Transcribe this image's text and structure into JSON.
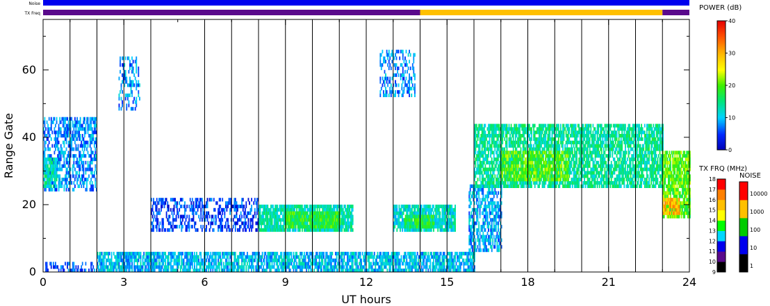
{
  "chart_data": {
    "type": "heatmap",
    "title": "",
    "xlabel": "UT hours",
    "ylabel": "Range Gate",
    "xlim": [
      0,
      24
    ],
    "ylim": [
      0,
      75
    ],
    "x_ticks": [
      0,
      3,
      6,
      9,
      12,
      15,
      18,
      21,
      24
    ],
    "y_ticks": [
      0,
      20,
      40,
      60
    ],
    "grid": false,
    "scan_boundaries_ut": [
      1.0,
      2.0,
      3.0,
      4.0,
      6.0,
      7.0,
      8.0,
      9.0,
      10.0,
      11.0,
      12.0,
      13.0,
      14.0,
      15.0,
      16.0,
      17.0,
      18.0,
      19.0,
      20.0,
      21.0,
      22.0,
      23.0
    ],
    "top_strips": {
      "noise_label": "Noise",
      "txfreq_label": "TX Freq",
      "noise_color": "#0000ee",
      "txfreq_segments": [
        {
          "start": 0,
          "end": 14.0,
          "color": "#5a0a8c"
        },
        {
          "start": 14.0,
          "end": 23.0,
          "color": "#ffc000"
        },
        {
          "start": 23.0,
          "end": 24.0,
          "color": "#5a0a8c"
        }
      ]
    },
    "power_colorbar": {
      "title": "POWER (dB)",
      "ticks": [
        0,
        10,
        20,
        30,
        40
      ],
      "range": [
        0,
        40
      ]
    },
    "txfreq_colorbar": {
      "title": "TX FRQ (MHz)",
      "ticks": [
        9,
        10,
        11,
        12,
        13,
        14,
        15,
        16,
        17,
        18
      ],
      "colors": [
        "#000000",
        "#5a0a8c",
        "#0000ee",
        "#00d8ff",
        "#00ff00",
        "#ffff00",
        "#ffc000",
        "#ff8000",
        "#ff0000"
      ]
    },
    "noise_colorbar": {
      "title": "NOISE",
      "ticks": [
        "1",
        "10",
        "100",
        "1000",
        "10000"
      ],
      "colors": [
        "#000000",
        "#0000ee",
        "#00cc00",
        "#ffc000",
        "#ff0000"
      ]
    },
    "echo_regions": [
      {
        "name": "early-band",
        "x0": 0.0,
        "x1": 2.0,
        "y0": 24,
        "y1": 46,
        "power": 8,
        "density": 0.55
      },
      {
        "name": "early-core",
        "x0": 0.0,
        "x1": 0.5,
        "y0": 25,
        "y1": 34,
        "power": 13,
        "density": 0.8
      },
      {
        "name": "mid-band",
        "x0": 4.0,
        "x1": 8.0,
        "y0": 12,
        "y1": 22,
        "power": 5,
        "density": 0.45
      },
      {
        "name": "day-echo-1",
        "x0": 8.0,
        "x1": 11.5,
        "y0": 12,
        "y1": 20,
        "power": 13,
        "density": 0.9
      },
      {
        "name": "day-echo-1-core",
        "x0": 9.0,
        "x1": 11.0,
        "y0": 13,
        "y1": 18,
        "power": 18,
        "density": 0.9
      },
      {
        "name": "day-echo-2",
        "x0": 13.0,
        "x1": 15.3,
        "y0": 12,
        "y1": 20,
        "power": 12,
        "density": 0.85
      },
      {
        "name": "day-echo-2-core",
        "x0": 13.4,
        "x1": 14.5,
        "y0": 13,
        "y1": 17,
        "power": 17,
        "density": 0.85
      },
      {
        "name": "near-ground",
        "x0": 2.0,
        "x1": 16.0,
        "y0": 0,
        "y1": 6,
        "power": 10,
        "density": 0.75
      },
      {
        "name": "ground-early",
        "x0": 0.0,
        "x1": 2.0,
        "y0": 0,
        "y1": 3,
        "power": 6,
        "density": 0.35
      },
      {
        "name": "slant-echo",
        "x0": 15.8,
        "x1": 17.0,
        "y0": 6,
        "y1": 26,
        "power": 9,
        "density": 0.6
      },
      {
        "name": "evening-band",
        "x0": 16.0,
        "x1": 23.0,
        "y0": 25,
        "y1": 44,
        "power": 14,
        "density": 0.75
      },
      {
        "name": "evening-core",
        "x0": 17.0,
        "x1": 19.5,
        "y0": 27,
        "y1": 36,
        "power": 20,
        "density": 0.75
      },
      {
        "name": "late-echo",
        "x0": 23.0,
        "x1": 24.0,
        "y0": 16,
        "y1": 36,
        "power": 20,
        "density": 0.85
      },
      {
        "name": "late-core",
        "x0": 23.0,
        "x1": 23.6,
        "y0": 17,
        "y1": 22,
        "power": 30,
        "density": 0.9
      },
      {
        "name": "high-patch-1",
        "x0": 12.5,
        "x1": 13.8,
        "y0": 52,
        "y1": 66,
        "power": 8,
        "density": 0.4
      },
      {
        "name": "high-patch-2",
        "x0": 2.8,
        "x1": 3.6,
        "y0": 48,
        "y1": 64,
        "power": 8,
        "density": 0.35
      }
    ]
  }
}
